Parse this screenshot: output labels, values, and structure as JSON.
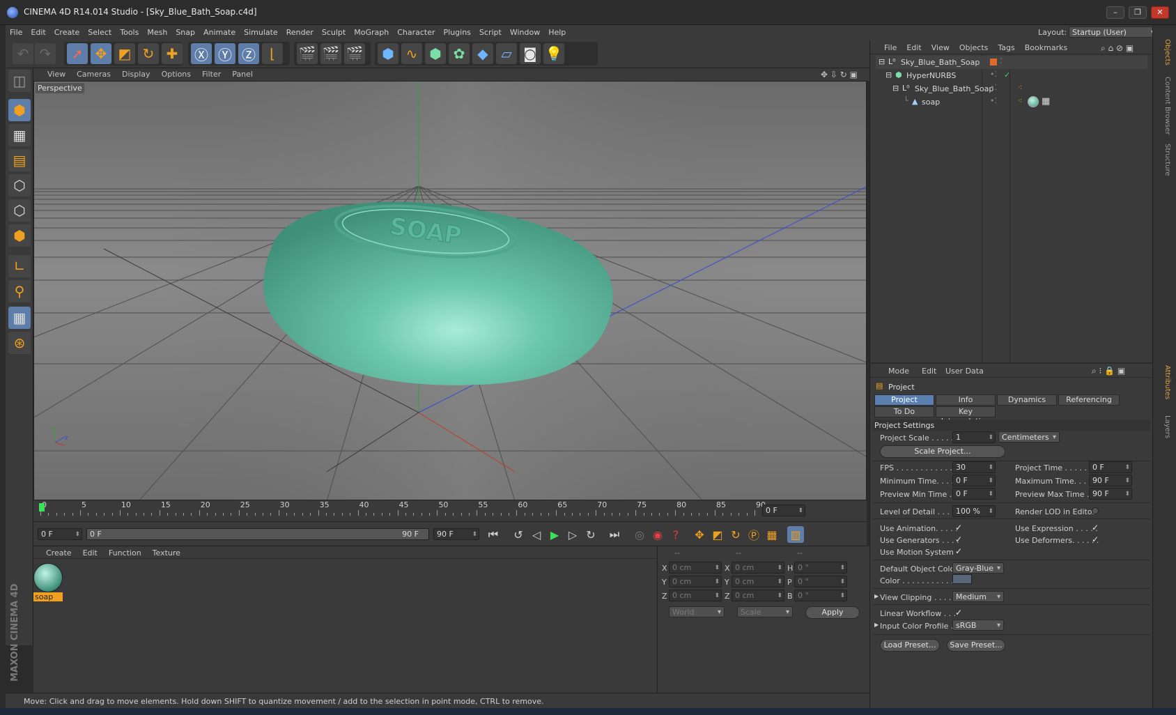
{
  "window": {
    "title": "CINEMA 4D R14.014 Studio - [Sky_Blue_Bath_Soap.c4d]",
    "minimize": "–",
    "restore": "❐",
    "close": "✕"
  },
  "menu": [
    "File",
    "Edit",
    "Create",
    "Select",
    "Tools",
    "Mesh",
    "Snap",
    "Animate",
    "Simulate",
    "Render",
    "Sculpt",
    "MoGraph",
    "Character",
    "Plugins",
    "Script",
    "Window",
    "Help"
  ],
  "layout": {
    "label": "Layout:",
    "value": "Startup (User)"
  },
  "viewport": {
    "menu": [
      "View",
      "Cameras",
      "Display",
      "Options",
      "Filter",
      "Panel"
    ],
    "label": "Perspective",
    "emboss": "SOAP",
    "axis_y": "y",
    "axis_z": "z"
  },
  "timeline": {
    "ticks": [
      "0",
      "5",
      "10",
      "15",
      "20",
      "25",
      "30",
      "35",
      "40",
      "45",
      "50",
      "55",
      "60",
      "65",
      "70",
      "75",
      "80",
      "85",
      "90"
    ],
    "current_frame": "0 F"
  },
  "transport": {
    "start": "0 F",
    "range_start": "0 F",
    "range_end": "90 F",
    "end": "90 F"
  },
  "material_manager": {
    "menu": [
      "Create",
      "Edit",
      "Function",
      "Texture"
    ],
    "materials": [
      {
        "name": "soap"
      }
    ]
  },
  "coordinates": {
    "headers": [
      "--",
      "--",
      "--"
    ],
    "rows": [
      {
        "a": "X",
        "av": "0 cm",
        "b": "X",
        "bv": "0 cm",
        "c": "H",
        "cv": "0 °"
      },
      {
        "a": "Y",
        "av": "0 cm",
        "b": "Y",
        "bv": "0 cm",
        "c": "P",
        "cv": "0 °"
      },
      {
        "a": "Z",
        "av": "0 cm",
        "b": "Z",
        "bv": "0 cm",
        "c": "B",
        "cv": "0 °"
      }
    ],
    "mode1": "World",
    "mode2": "Scale",
    "apply": "Apply"
  },
  "object_manager": {
    "menu": [
      "File",
      "Edit",
      "View",
      "Objects",
      "Tags",
      "Bookmarks"
    ],
    "objects": [
      {
        "name": "Sky_Blue_Bath_Soap",
        "icon": "null-icon"
      },
      {
        "name": "HyperNURBS",
        "icon": "hypernurbs-icon"
      },
      {
        "name": "Sky_Blue_Bath_Soap",
        "icon": "null-icon"
      },
      {
        "name": "soap",
        "icon": "polygon-icon"
      }
    ]
  },
  "attributes": {
    "menu": [
      "Mode",
      "Edit",
      "User Data"
    ],
    "title": "Project",
    "tabs": [
      "Project Settings",
      "Info",
      "Dynamics",
      "Referencing",
      "To Do",
      "Key Interpolation"
    ],
    "section": "Project Settings",
    "project_scale": {
      "label": "Project Scale . . . . . .",
      "value": "1",
      "unit": "Centimeters"
    },
    "scale_btn": "Scale Project...",
    "fps": {
      "label": "FPS . . . . . . . . . . . . . .",
      "value": "30"
    },
    "project_time": {
      "label": "Project Time . . . . . . . .",
      "value": "0 F"
    },
    "min_time": {
      "label": "Minimum Time. . . . .",
      "value": "0 F"
    },
    "max_time": {
      "label": "Maximum Time. . . . .",
      "value": "90 F"
    },
    "prev_min": {
      "label": "Preview Min Time . .",
      "value": "0 F"
    },
    "prev_max": {
      "label": "Preview Max Time . . .",
      "value": "90 F"
    },
    "lod": {
      "label": "Level of Detail . . . . .",
      "value": "100 %"
    },
    "render_lod": "Render LOD in Editor",
    "use_animation": "Use Animation. . . . .",
    "use_expression": "Use Expression . . . . .",
    "use_generators": "Use Generators . . . .",
    "use_deformers": "Use Deformers. . . . . .",
    "use_motion": "Use Motion System",
    "default_color": {
      "label": "Default Object Color",
      "value": "Gray-Blue"
    },
    "color": {
      "label": "Color . . . . . . . . . . ."
    },
    "view_clipping": {
      "label": "View Clipping . . . . .",
      "value": "Medium"
    },
    "linear_workflow": "Linear Workflow . . .",
    "input_profile": {
      "label": "Input Color Profile .",
      "value": "sRGB"
    },
    "load_preset": "Load Preset...",
    "save_preset": "Save Preset...",
    "check": "✓"
  },
  "side_tabs": [
    "Objects",
    "Content Browser",
    "Structure",
    "Attributes",
    "Layers"
  ],
  "status": "Move: Click and drag to move elements. Hold down SHIFT to quantize movement / add to the selection in point mode, CTRL to remove.",
  "brand": "MAXON CINEMA 4D",
  "icons": {
    "undo": "↶",
    "redo": "↷",
    "cube": "⬢",
    "checker": "▦"
  }
}
